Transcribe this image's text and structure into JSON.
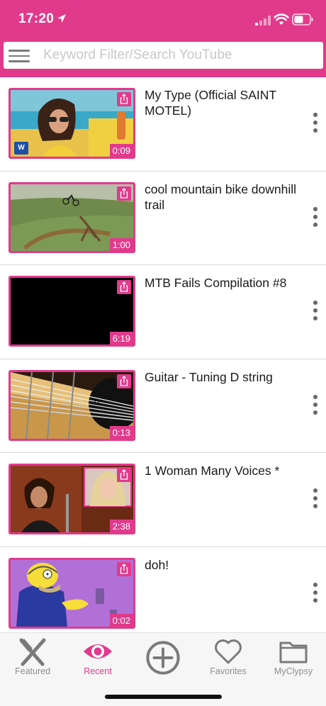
{
  "status_bar": {
    "time": "17:20"
  },
  "search": {
    "placeholder": "Keyword Filter/Search YouTube",
    "value": ""
  },
  "videos": [
    {
      "title": "My Type (Official SAINT MOTEL)",
      "duration": "0:09",
      "badge": "W"
    },
    {
      "title": "cool mountain bike downhill trail",
      "duration": "1:00"
    },
    {
      "title": "MTB Fails Compilation #8",
      "duration": "6:19"
    },
    {
      "title": "Guitar - Tuning D string",
      "duration": "0:13"
    },
    {
      "title": "1 Woman Many Voices *",
      "duration": "2:38"
    },
    {
      "title": "doh!",
      "duration": "0:02"
    }
  ],
  "tabs": [
    {
      "label": "Featured",
      "icon": "scissors-icon",
      "active": false
    },
    {
      "label": "Recent",
      "icon": "eye-icon",
      "active": true
    },
    {
      "label": "",
      "icon": "add-circle-icon",
      "active": false
    },
    {
      "label": "Favorites",
      "icon": "heart-icon",
      "active": false
    },
    {
      "label": "MyClypsy",
      "icon": "folder-icon",
      "active": false
    }
  ],
  "colors": {
    "accent": "#e13a8c",
    "tab_inactive": "#8e8e8e",
    "text": "#1a1a1a"
  }
}
